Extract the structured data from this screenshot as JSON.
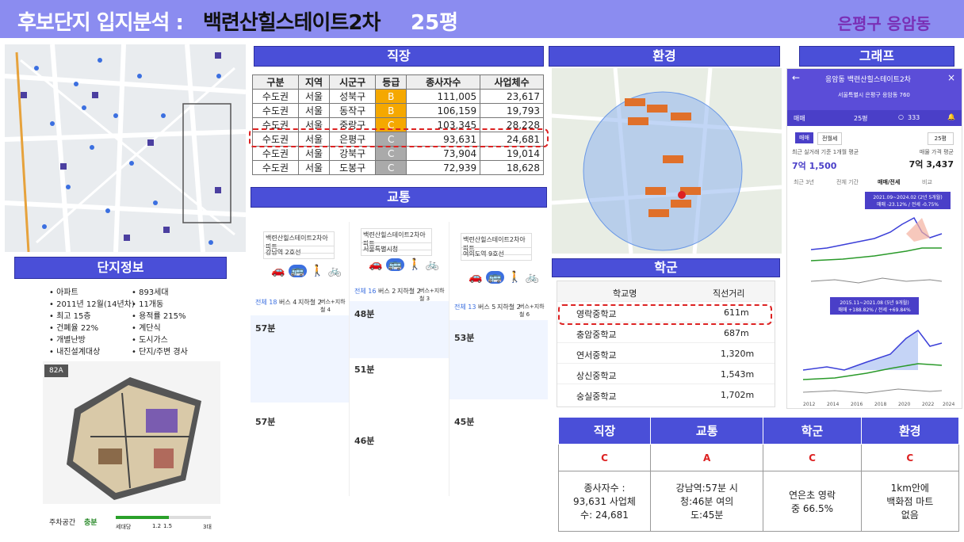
{
  "header": {
    "prefix": "후보단지 입지분석 : ",
    "name": "백련산힐스테이트2차",
    "size": "25평",
    "region": "은평구 응암동"
  },
  "sections": {
    "job": "직장",
    "env": "환경",
    "graph": "그래프",
    "traffic": "교통",
    "school": "학군",
    "complex": "단지정보"
  },
  "job_table": {
    "headers": [
      "구분",
      "지역",
      "시군구",
      "등급",
      "종사자수",
      "사업체수"
    ],
    "rows": [
      [
        "수도권",
        "서울",
        "성북구",
        "B",
        "111,005",
        "23,617"
      ],
      [
        "수도권",
        "서울",
        "동작구",
        "B",
        "106,159",
        "19,793"
      ],
      [
        "수도권",
        "서울",
        "중랑구",
        "C",
        "103,345",
        "28,228"
      ],
      [
        "수도권",
        "서울",
        "은평구",
        "C",
        "93,631",
        "24,681"
      ],
      [
        "수도권",
        "서울",
        "강북구",
        "C",
        "73,904",
        "19,014"
      ],
      [
        "수도권",
        "서울",
        "도봉구",
        "C",
        "72,939",
        "18,628"
      ]
    ]
  },
  "complex_info": {
    "left": [
      "아파트",
      "2011년 12월(14년차)",
      "최고 15층",
      "건폐율 22%",
      "개별난방",
      "내진설계대상"
    ],
    "right": [
      "893세대",
      "11개동",
      "용적률 215%",
      "계단식",
      "도시가스",
      "단지/주변 경사"
    ],
    "plan_label": "82A",
    "parking_label": "주차공간",
    "parking_value": "충분",
    "parking_scale": [
      "세대당",
      "1.2",
      "1.5",
      "3대"
    ]
  },
  "traffic": {
    "col1": {
      "from": "백련산힐스테이트2차아파트",
      "to": "강남역 2호선",
      "tabs": [
        "전체 18",
        "버스 4",
        "지하철 2",
        "버스+지하철 4"
      ],
      "routes": [
        "57분",
        "57분"
      ]
    },
    "col2": {
      "from": "백련산힐스테이트2차아파트",
      "to": "서울특별시청",
      "tabs": [
        "전체 16",
        "버스 2",
        "지하철 2",
        "버스+지하철 3"
      ],
      "routes": [
        "48분",
        "51분",
        "46분"
      ]
    },
    "col3": {
      "from": "백련산힐스테이트2차아파트",
      "to": "여의도역 9호선",
      "tabs": [
        "전체 13",
        "버스 5",
        "지하철 2",
        "버스+지하철 6"
      ],
      "routes": [
        "53분",
        "45분"
      ]
    }
  },
  "schools": {
    "headers": [
      "학교명",
      "직선거리"
    ],
    "rows": [
      [
        "영락중학교",
        "611m"
      ],
      [
        "충암중학교",
        "687m"
      ],
      [
        "연서중학교",
        "1,320m"
      ],
      [
        "상신중학교",
        "1,543m"
      ],
      [
        "숭실중학교",
        "1,702m"
      ]
    ]
  },
  "summary": {
    "headers": [
      "직장",
      "교통",
      "학군",
      "환경"
    ],
    "grades": [
      "C",
      "A",
      "C",
      "C"
    ],
    "details": [
      "종사자수 : 93,631 사업체수: 24,681",
      "강남역:57분 시청:46분 여의도:45분",
      "연은초 영락중 66.5%",
      "1km안에 백화점 마트 없음"
    ]
  },
  "phone": {
    "title": "응암동 백련산힐스테이트2차",
    "address": "서울특별시 은평구 응암동 760",
    "tabs": [
      "매매",
      "25평",
      "333"
    ],
    "sub_tabs": [
      "매매",
      "전월세"
    ],
    "size_select": "25평",
    "recent_label": "최근 실거래 기준 1개월 평균",
    "recent_value": "7억 1,500",
    "ask_label": "매물 가격 평균",
    "ask_value": "7억 3,437",
    "periods": [
      "최근 3년",
      "전체 기간",
      "매매/전세",
      "비교"
    ],
    "note1": "2021.09~2024.02 (2년 5개월)",
    "note1b": "매매 -23.12% / 전세 -0.75%",
    "note2": "2015.11~2021.08 (5년 9개월)",
    "note2b": "매매 +188.82% / 전세 +69.84%",
    "years": [
      "2012",
      "2014",
      "2016",
      "2018",
      "2020",
      "2022",
      "2024"
    ]
  },
  "colors": {
    "accent": "#4a4fd8",
    "header": "#8b8cf0",
    "red": "#d22222",
    "grade_b": "#f5a800"
  }
}
